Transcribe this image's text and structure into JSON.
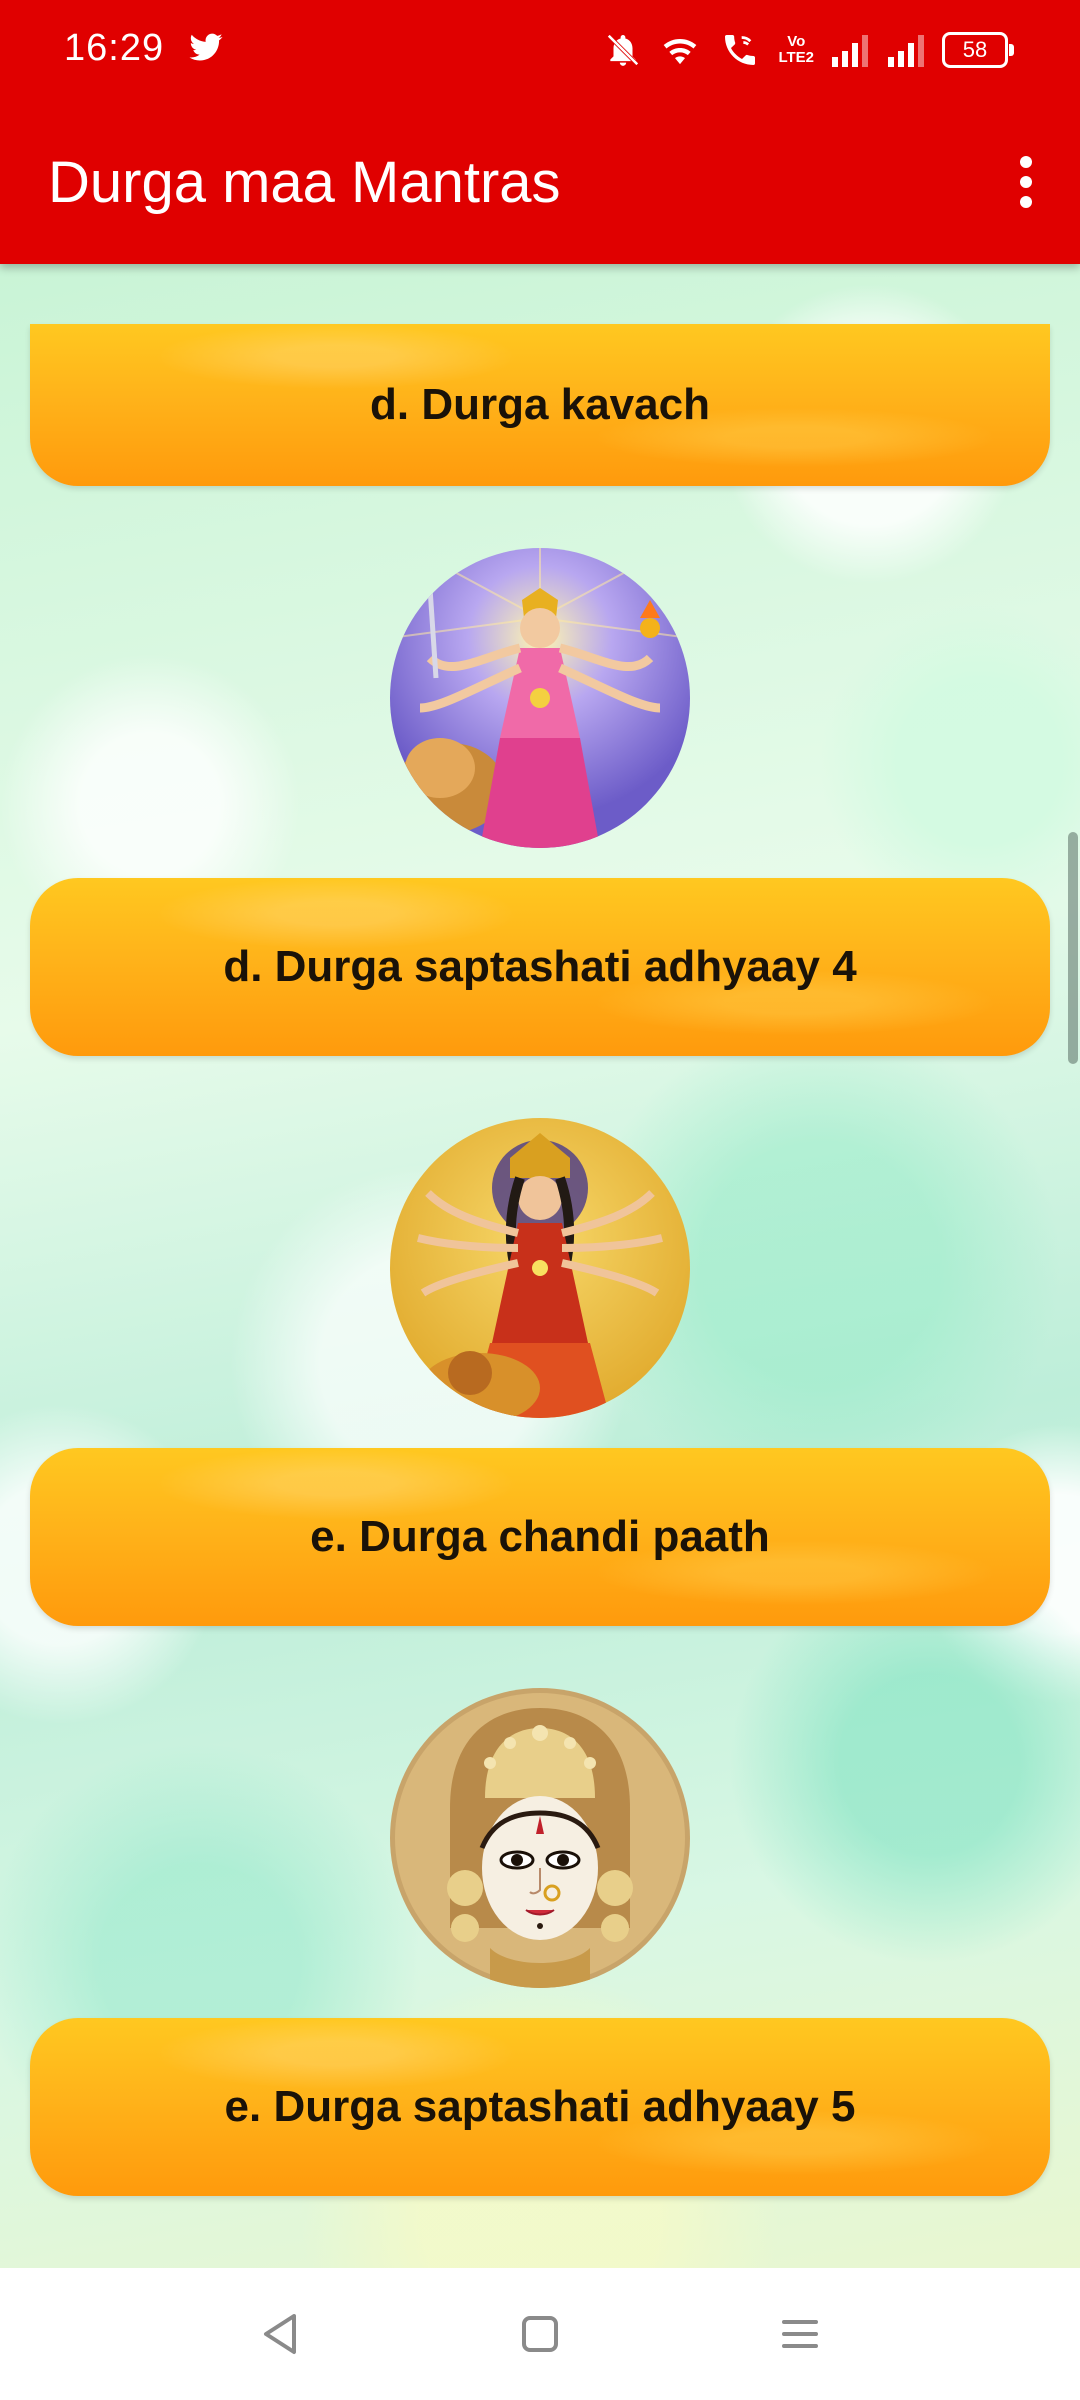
{
  "status_bar": {
    "time": "16:29",
    "battery": "58",
    "volte_top": "Vo",
    "volte_bottom": "LTE2",
    "icons": [
      "twitter-icon",
      "mute-bell-icon",
      "wifi-icon",
      "wifi-calling-icon",
      "volte-icon",
      "signal-icon",
      "signal-icon",
      "battery-icon"
    ]
  },
  "app_bar": {
    "title": "Durga maa Mantras",
    "overflow_icon": "more-vert-icon"
  },
  "items": [
    {
      "label": "d. Durga kavach"
    },
    {
      "image": "durga-maa-image"
    },
    {
      "label": "d. Durga saptashati adhyaay 4"
    },
    {
      "image": "durga-maa-image"
    },
    {
      "label": "e. Durga chandi paath"
    },
    {
      "image": "durga-maa-face-image"
    },
    {
      "label": "e. Durga saptashati adhyaay 5"
    }
  ],
  "nav_bar": {
    "icons": [
      "back-icon",
      "home-icon",
      "menu-icon"
    ]
  },
  "colors": {
    "app_bar": "#e00000",
    "button_top": "#ffc820",
    "button_bottom": "#ff9a0c",
    "button_text": "#1a1208"
  }
}
